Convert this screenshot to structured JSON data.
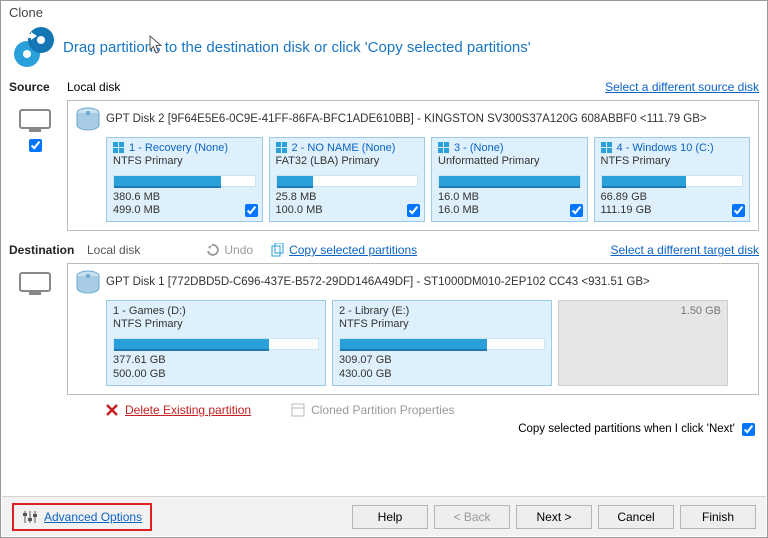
{
  "title": "Clone",
  "header_text": "Drag partitions to the destination disk or click 'Copy selected partitions'",
  "source": {
    "label": "Source",
    "disk_type": "Local disk",
    "select_link": "Select a different source disk",
    "disk_title": "GPT Disk 2 [9F64E5E6-0C9E-41FF-86FA-BFC1ADE610BB] - KINGSTON SV300S37A120G 608ABBF0  <111.79 GB>",
    "partitions": [
      {
        "name": "1 - Recovery (None)",
        "fs": "NTFS Primary",
        "used": "380.6 MB",
        "total": "499.0 MB",
        "fill_pct": 76,
        "checked": true
      },
      {
        "name": "2 - NO NAME (None)",
        "fs": "FAT32 (LBA) Primary",
        "used": "25.8 MB",
        "total": "100.0 MB",
        "fill_pct": 26,
        "checked": true
      },
      {
        "name": "3 -   (None)",
        "fs": "Unformatted Primary",
        "used": "16.0 MB",
        "total": "16.0 MB",
        "fill_pct": 100,
        "checked": true
      },
      {
        "name": "4 - Windows 10 (C:)",
        "fs": "NTFS Primary",
        "used": "66.89 GB",
        "total": "111.19 GB",
        "fill_pct": 60,
        "checked": true
      }
    ]
  },
  "destination": {
    "label": "Destination",
    "disk_type": "Local disk",
    "undo": "Undo",
    "copy_link": "Copy selected partitions",
    "select_link": "Select a different target disk",
    "disk_title": "GPT Disk 1 [772DBD5D-C696-437E-B572-29DD146A49DF] - ST1000DM010-2EP102 CC43  <931.51 GB>",
    "partitions": [
      {
        "name": "1 - Games (D:)",
        "fs": "NTFS Primary",
        "used": "377.61 GB",
        "total": "500.00 GB",
        "fill_pct": 76
      },
      {
        "name": "2 - Library (E:)",
        "fs": "NTFS Primary",
        "used": "309.07 GB",
        "total": "430.00 GB",
        "fill_pct": 72
      }
    ],
    "free_space": "1.50 GB"
  },
  "actions": {
    "delete": "Delete Existing partition",
    "props": "Cloned Partition Properties"
  },
  "footer": {
    "opt_label": "Copy selected partitions when I click 'Next'",
    "advanced": "Advanced Options",
    "help": "Help",
    "back": "< Back",
    "next": "Next >",
    "cancel": "Cancel",
    "finish": "Finish"
  }
}
